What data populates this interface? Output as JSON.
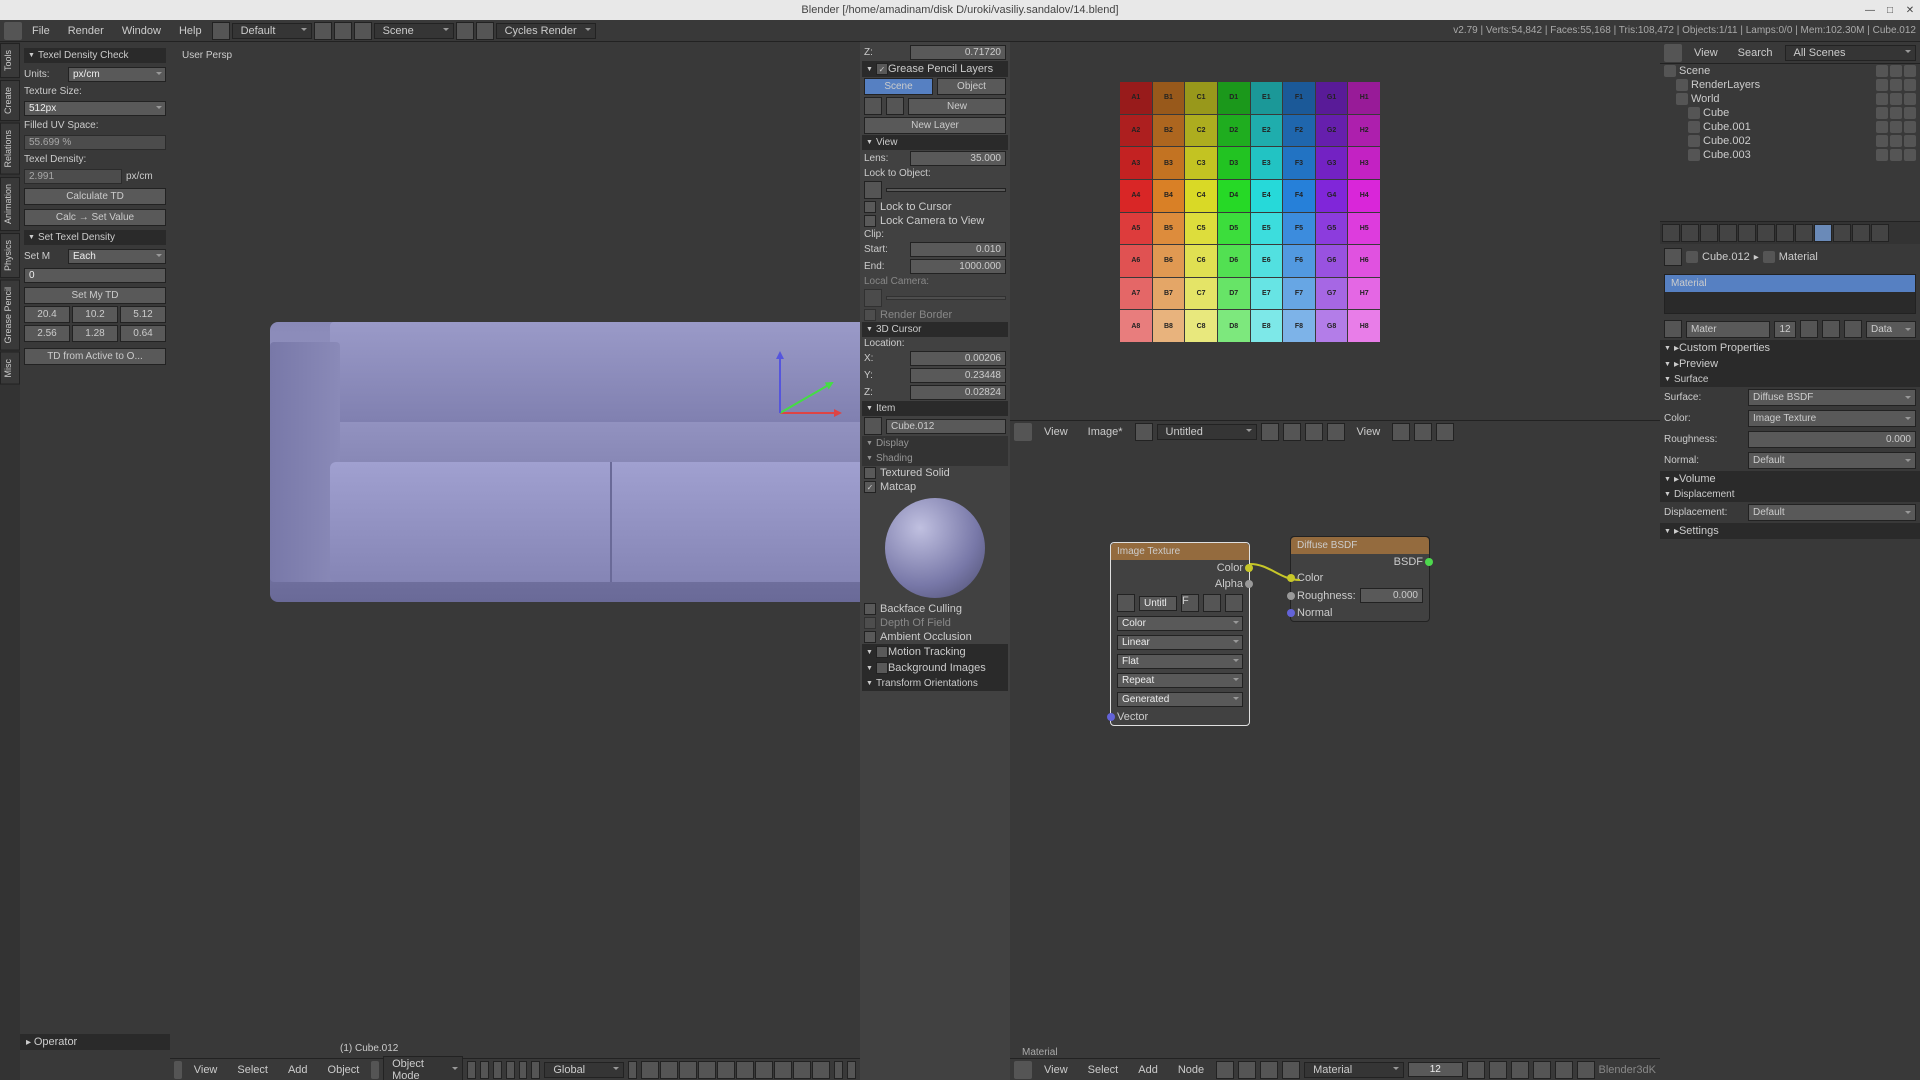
{
  "window": {
    "title": "Blender [/home/amadinam/disk D/uroki/vasiliy.sandalov/14.blend]"
  },
  "menubar": {
    "file": "File",
    "render": "Render",
    "window": "Window",
    "help": "Help",
    "layout": "Default",
    "scene": "Scene",
    "engine": "Cycles Render",
    "info": "v2.79 | Verts:54,842 | Faces:55,168 | Tris:108,472 | Objects:1/11 | Lamps:0/0 | Mem:102.30M | Cube.012"
  },
  "toolpanel": {
    "hdr0": "Texel Density Check",
    "units_l": "Units:",
    "units_v": "px/cm",
    "tsize_l": "Texture Size:",
    "tsize_v": "512px",
    "filled_l": "Filled UV Space:",
    "filled_v": "55.699 %",
    "td_l": "Texel Density:",
    "td_v": "2.991",
    "td_u": "px/cm",
    "calc": "Calculate TD",
    "calcset": "Calc → Set Value",
    "hdr1": "Set Texel Density",
    "setm_l": "Set M",
    "setm_v": "Each",
    "zero": "0",
    "setmy": "Set My TD",
    "r1": [
      "20.4",
      "10.2",
      "5.12"
    ],
    "r2": [
      "2.56",
      "1.28",
      "0.64"
    ],
    "tdact": "TD from Active to O...",
    "op": "Operator"
  },
  "view3d": {
    "persp": "User Persp",
    "obj": "(1) Cube.012",
    "foot": {
      "view": "View",
      "select": "Select",
      "add": "Add",
      "object": "Object",
      "mode": "Object Mode",
      "global": "Global"
    }
  },
  "npanel": {
    "z": "Z:",
    "zval": "0.71720",
    "gp": "Grease Pencil Layers",
    "scenebtn": "Scene",
    "objbtn": "Object",
    "new": "New",
    "newlayer": "New Layer",
    "viewh": "View",
    "lens": "Lens:",
    "lensv": "35.000",
    "lockobj": "Lock to Object:",
    "lockcur": "Lock to Cursor",
    "lockcam": "Lock Camera to View",
    "clip": "Clip:",
    "start": "Start:",
    "startv": "0.010",
    "end": "End:",
    "endv": "1000.000",
    "locam": "Local Camera:",
    "rendb": "Render Border",
    "cur3d": "3D Cursor",
    "loc": "Location:",
    "x": "X:",
    "xv": "0.00206",
    "y": "Y:",
    "yv": "0.23448",
    "zc": "Z:",
    "zcv": "0.02824",
    "item": "Item",
    "itemv": "Cube.012",
    "disp": "Display",
    "shade": "Shading",
    "texsolid": "Textured Solid",
    "matcap": "Matcap",
    "bface": "Backface Culling",
    "dof": "Depth Of Field",
    "ao": "Ambient Occlusion",
    "motion": "Motion Tracking",
    "bgimg": "Background Images",
    "torient": "Transform Orientations"
  },
  "uv": {
    "view": "View",
    "image": "Image*",
    "untitled": "Untitled"
  },
  "nodes": {
    "imgtex": "Image Texture",
    "color": "Color",
    "alpha": "Alpha",
    "untitl": "Untitl",
    "cmode": "Color",
    "linear": "Linear",
    "flat": "Flat",
    "repeat": "Repeat",
    "gen": "Generated",
    "vector": "Vector",
    "diffuse": "Diffuse BSDF",
    "bsdf": "BSDF",
    "colin": "Color",
    "rough": "Roughness:",
    "roughv": "0.000",
    "normal": "Normal",
    "matlabel": "Material",
    "foot": {
      "view": "View",
      "select": "Select",
      "add": "Add",
      "node": "Node",
      "mat": "Material",
      "num": "12"
    }
  },
  "outliner": {
    "view": "View",
    "search": "Search",
    "all": "All Scenes",
    "items": [
      "Scene",
      "RenderLayers",
      "World",
      "Cube",
      "Cube.001",
      "Cube.002",
      "Cube.003"
    ]
  },
  "props": {
    "crumb_obj": "Cube.012",
    "crumb_mat": "Material",
    "mat": "Material",
    "mater": "Mater",
    "twelve": "12",
    "data": "Data",
    "custom": "Custom Properties",
    "preview": "Preview",
    "surface": "Surface",
    "surf_l": "Surface:",
    "surf_v": "Diffuse BSDF",
    "col_l": "Color:",
    "col_v": "Image Texture",
    "rough_l": "Roughness:",
    "rough_v": "0.000",
    "norm_l": "Normal:",
    "norm_v": "Default",
    "vol": "Volume",
    "disp": "Displacement",
    "disp_l": "Displacement:",
    "disp_v": "Default",
    "set": "Settings"
  },
  "chart_data": {
    "type": "table",
    "description": "UV color grid 8x8 shown in UV/Image editor",
    "cells": [
      [
        "A1",
        "B1",
        "C1",
        "D1",
        "E1",
        "F1",
        "G1",
        "H1"
      ],
      [
        "A2",
        "B2",
        "C2",
        "D2",
        "E2",
        "F2",
        "G2",
        "H2"
      ],
      [
        "A3",
        "B3",
        "C3",
        "D3",
        "E3",
        "F3",
        "G3",
        "H3"
      ],
      [
        "A4",
        "B4",
        "C4",
        "D4",
        "E4",
        "F4",
        "G4",
        "H4"
      ],
      [
        "A5",
        "B5",
        "C5",
        "D5",
        "E5",
        "F5",
        "G5",
        "H5"
      ],
      [
        "A6",
        "B6",
        "C6",
        "D6",
        "E6",
        "F6",
        "G6",
        "H6"
      ],
      [
        "A7",
        "B7",
        "C7",
        "D7",
        "E7",
        "F7",
        "G7",
        "H7"
      ],
      [
        "A8",
        "B8",
        "C8",
        "D8",
        "E8",
        "F8",
        "G8",
        "H8"
      ]
    ],
    "hues_deg": [
      0,
      30,
      60,
      120,
      180,
      210,
      270,
      300
    ]
  }
}
